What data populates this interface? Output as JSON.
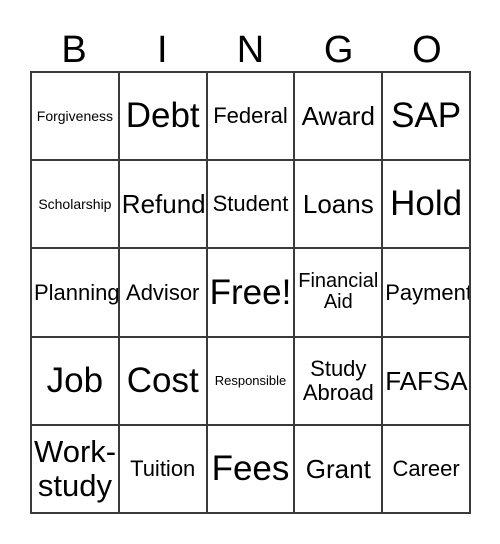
{
  "card": {
    "title": "BINGO",
    "background_color": "#ffffff",
    "text_color": "#000000",
    "border_color": "#3a3a3a",
    "columns": 5,
    "rows": 5,
    "header_letters": [
      "B",
      "I",
      "N",
      "G",
      "O"
    ],
    "free_space_label": "Free!",
    "cells": [
      {
        "text": "Forgiveness",
        "size": "fs-xs"
      },
      {
        "text": "Debt",
        "size": "fs-xxl"
      },
      {
        "text": "Federal",
        "size": "fs-md"
      },
      {
        "text": "Award",
        "size": "fs-lg"
      },
      {
        "text": "SAP",
        "size": "fs-xxl"
      },
      {
        "text": "Scholarship",
        "size": "fs-xs"
      },
      {
        "text": "Refund",
        "size": "fs-lg"
      },
      {
        "text": "Student",
        "size": "fs-md"
      },
      {
        "text": "Loans",
        "size": "fs-lg"
      },
      {
        "text": "Hold",
        "size": "fs-xxl"
      },
      {
        "text": "Planning",
        "size": "fs-md"
      },
      {
        "text": "Advisor",
        "size": "fs-md"
      },
      {
        "text": "Free!",
        "size": "fs-xxl"
      },
      {
        "text": "Financial\nAid",
        "size": "fs-sm"
      },
      {
        "text": "Payment",
        "size": "fs-md"
      },
      {
        "text": "Job",
        "size": "fs-xxl"
      },
      {
        "text": "Cost",
        "size": "fs-xxl"
      },
      {
        "text": "Responsible",
        "size": "fs-xxs"
      },
      {
        "text": "Study\nAbroad",
        "size": "fs-md"
      },
      {
        "text": "FAFSA",
        "size": "fs-lg"
      },
      {
        "text": "Work-\nstudy",
        "size": "fs-xl"
      },
      {
        "text": "Tuition",
        "size": "fs-md"
      },
      {
        "text": "Fees",
        "size": "fs-xxl"
      },
      {
        "text": "Grant",
        "size": "fs-lg"
      },
      {
        "text": "Career",
        "size": "fs-md"
      }
    ]
  }
}
